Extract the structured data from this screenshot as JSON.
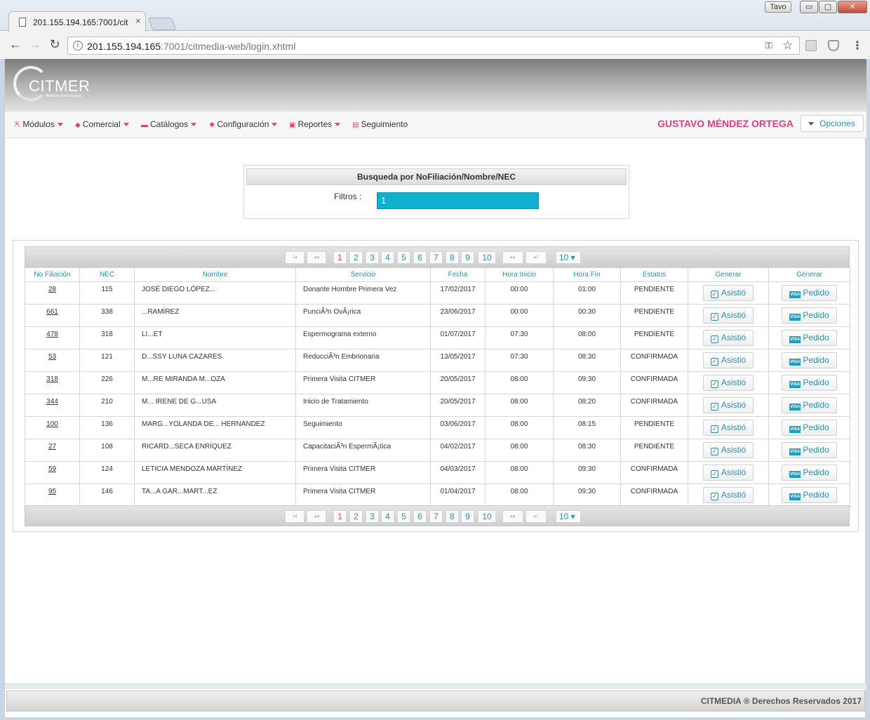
{
  "browser": {
    "tab_title": "201.155.194.165:7001/cit",
    "tab_close": "×",
    "user_chip": "Tavo",
    "url_host": "201.155.194.165",
    "url_path": ":7001/citmedia-web/login.xhtml",
    "win_min": "▭",
    "win_max": "▢",
    "win_close": "✕"
  },
  "app": {
    "logo_text": "CITMER",
    "logo_sub": "Medicina Reproductiva",
    "menu": [
      {
        "label": "Módulos",
        "icon": "external-link-icon"
      },
      {
        "label": "Comercial",
        "icon": "tag-icon"
      },
      {
        "label": "Catálogos",
        "icon": "folder-icon"
      },
      {
        "label": "Configuración",
        "icon": "gear-icon"
      },
      {
        "label": "Reportes",
        "icon": "image-icon"
      },
      {
        "label": "Seguimiento",
        "icon": "chat-icon"
      }
    ],
    "user_name": "GUSTAVO MÉNDEZ ORTEGA",
    "options_label": "Opciones"
  },
  "search": {
    "title": "Busqueda por NoFiliación/Nombre/NEC",
    "filter_label": "Filtros :",
    "filter_value": "1"
  },
  "pager": {
    "first": "I◂",
    "prev": "◂◂",
    "pages": [
      "1",
      "2",
      "3",
      "4",
      "5",
      "6",
      "7",
      "8",
      "9",
      "10"
    ],
    "active_page": "1",
    "next": "▸▸",
    "last": "▸I",
    "rows_per_page": "10 ▾"
  },
  "table": {
    "headers": [
      "No Filiación",
      "NEC",
      "Nombre",
      "Servicio",
      "Fecha",
      "Hora Inicio",
      "Hora Fin",
      "Estatus",
      "Generar",
      "Generar"
    ],
    "asistio_label": "Asistió",
    "pedido_label": "Pedido",
    "visa_text": "VISA",
    "rows": [
      {
        "fil": "28",
        "nec": "115",
        "nombre": "JOSÉ DIEGO LÓPEZ...",
        "servicio": "Donante Hombre Primera Vez",
        "fecha": "17/02/2017",
        "inicio": "00:00",
        "fin": "01:00",
        "estatus": "PENDIENTE"
      },
      {
        "fil": "661",
        "nec": "338",
        "nombre": "...RAMÍREZ",
        "servicio": "PunciÃ³n OvÃ¡rica",
        "fecha": "23/06/2017",
        "inicio": "00:00",
        "fin": "00:30",
        "estatus": "PENDIENTE"
      },
      {
        "fil": "478",
        "nec": "318",
        "nombre": "LI...ET",
        "servicio": "Espermograma externo",
        "fecha": "01/07/2017",
        "inicio": "07:30",
        "fin": "08:00",
        "estatus": "PENDIENTE"
      },
      {
        "fil": "53",
        "nec": "121",
        "nombre": "D...SSY LUNA CAZARES",
        "servicio": "ReducciÃ³n Embrionaria",
        "fecha": "13/05/2017",
        "inicio": "07:30",
        "fin": "08:30",
        "estatus": "CONFIRMADA"
      },
      {
        "fil": "318",
        "nec": "226",
        "nombre": "M...RE MIRANDA M...OZA",
        "servicio": "Primera Visita CITMER",
        "fecha": "20/05/2017",
        "inicio": "08:00",
        "fin": "09:30",
        "estatus": "CONFIRMADA"
      },
      {
        "fil": "344",
        "nec": "210",
        "nombre": "M... IRENE DE G...USA",
        "servicio": "Inicio de Tratamiento",
        "fecha": "20/05/2017",
        "inicio": "08:00",
        "fin": "08:20",
        "estatus": "CONFIRMADA"
      },
      {
        "fil": "100",
        "nec": "136",
        "nombre": "MARG...YOLANDA DE... HERNANDEZ",
        "servicio": "Seguimiento",
        "fecha": "03/06/2017",
        "inicio": "08:00",
        "fin": "08:15",
        "estatus": "PENDIENTE"
      },
      {
        "fil": "27",
        "nec": "108",
        "nombre": "RICARD...SECA ENRÍQUEZ",
        "servicio": "CapacitaciÃ³n EspermÃ¡tica",
        "fecha": "04/02/2017",
        "inicio": "08:00",
        "fin": "08:30",
        "estatus": "PENDIENTE"
      },
      {
        "fil": "59",
        "nec": "124",
        "nombre": "LETICIA MENDOZA MARTÍNEZ",
        "servicio": "Primera Visita CITMER",
        "fecha": "04/03/2017",
        "inicio": "08:00",
        "fin": "09:30",
        "estatus": "CONFIRMADA"
      },
      {
        "fil": "95",
        "nec": "146",
        "nombre": "TA...A GAR...MART...EZ",
        "servicio": "Primera Visita CITMER",
        "fecha": "01/04/2017",
        "inicio": "08:00",
        "fin": "09:30",
        "estatus": "CONFIRMADA"
      }
    ]
  },
  "footer": {
    "text": "CITMEDIA ® Derechos Reservados 2017"
  }
}
